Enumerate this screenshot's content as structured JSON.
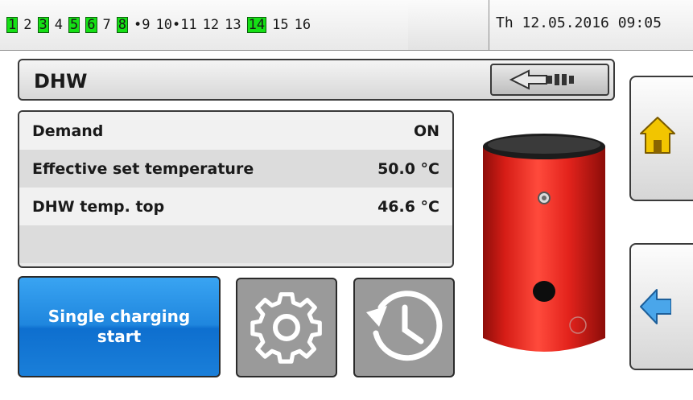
{
  "status_bar": {
    "outputs": [
      {
        "label": "1",
        "active": true
      },
      {
        "label": "2",
        "active": false
      },
      {
        "label": "3",
        "active": true
      },
      {
        "label": "4",
        "active": false
      },
      {
        "label": "5",
        "active": true
      },
      {
        "label": "6",
        "active": true
      },
      {
        "label": "7",
        "active": false
      },
      {
        "label": "8",
        "active": true
      },
      {
        "label": "•9",
        "active": false
      },
      {
        "label": "10•11",
        "active": false
      },
      {
        "label": "12",
        "active": false
      },
      {
        "label": "13",
        "active": false
      },
      {
        "label": "14",
        "active": true
      },
      {
        "label": "15",
        "active": false
      },
      {
        "label": "16",
        "active": false
      }
    ],
    "datetime": "Th 12.05.2016 09:05",
    "active_color": "#15e015"
  },
  "header": {
    "title": "DHW",
    "back_icon": "back-arrow-icon"
  },
  "values": [
    {
      "label": "Demand",
      "value": "ON"
    },
    {
      "label": "Effective set temperature",
      "value": "50.0 °C"
    },
    {
      "label": "DHW temp. top",
      "value": "46.6 °C"
    }
  ],
  "buttons": {
    "charge": {
      "line1": "Single charging",
      "line2": "start"
    },
    "settings_icon": "gear-icon",
    "timer_icon": "clock-history-icon"
  },
  "side_nav": {
    "home_icon": "home-icon",
    "back_icon": "left-arrow-icon"
  },
  "colors": {
    "tank_red": "#e3231c",
    "button_blue": "#1f86de",
    "home_yellow": "#f2c500"
  }
}
